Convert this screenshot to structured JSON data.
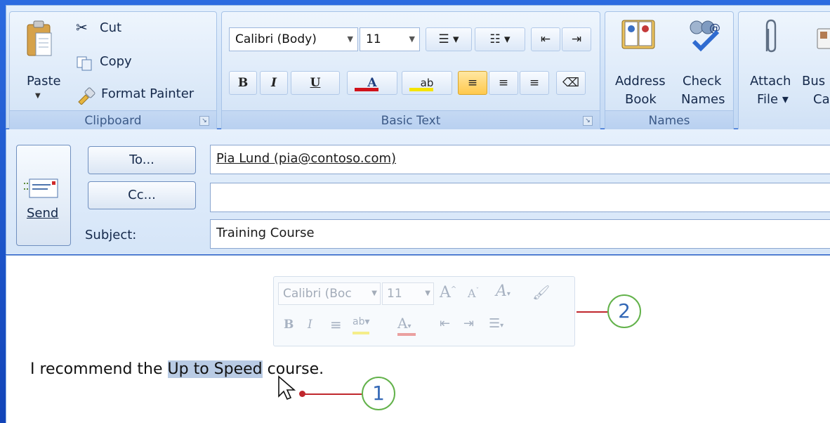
{
  "clipboard": {
    "paste_label": "Paste",
    "cut_label": "Cut",
    "copy_label": "Copy",
    "format_painter_label": "Format Painter",
    "group_label": "Clipboard"
  },
  "basic_text": {
    "font_name": "Calibri (Body)",
    "font_size": "11",
    "bold": "B",
    "italic": "I",
    "underline": "U",
    "font_color": "A",
    "highlight": "ab",
    "group_label": "Basic Text"
  },
  "names": {
    "address_book_line1": "Address",
    "address_book_line2": "Book",
    "check_names_line1": "Check",
    "check_names_line2": "Names",
    "group_label": "Names"
  },
  "include": {
    "attach_file_line1": "Attach",
    "attach_file_line2": "File",
    "business_card_line1": "Bus",
    "business_card_line2": "Ca"
  },
  "message": {
    "send_label": "Send",
    "to_button": "To...",
    "cc_button": "Cc...",
    "subject_label": "Subject:",
    "to_value": "Pia Lund (pia@contoso.com)",
    "cc_value": "",
    "subject_value": "Training Course"
  },
  "body": {
    "text_before": "I recommend the ",
    "selected_text": "Up to Speed",
    "text_after": " course."
  },
  "mini_toolbar": {
    "font_name": "Calibri (Boc",
    "font_size": "11"
  },
  "callouts": {
    "one": "1",
    "two": "2"
  }
}
